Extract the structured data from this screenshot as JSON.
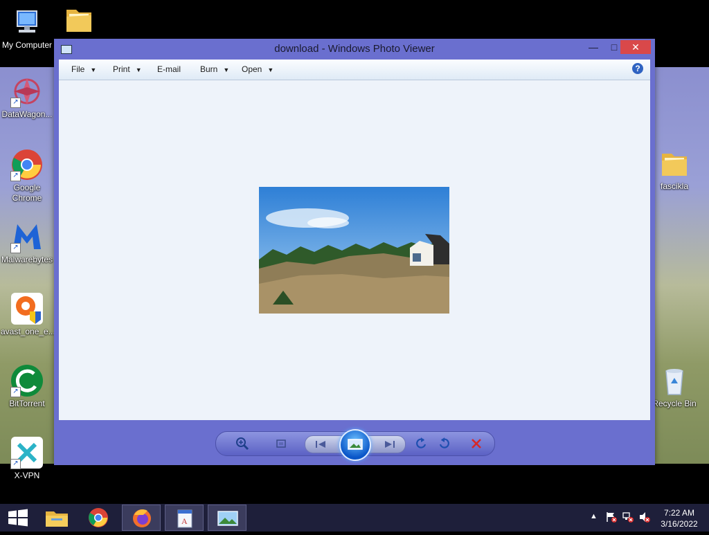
{
  "desktop": {
    "icons_left": [
      {
        "label": "My Computer",
        "icon": "computer-icon"
      },
      {
        "label": "DataWagon...",
        "icon": "datawagon-icon"
      },
      {
        "label": "Google\nChrome",
        "icon": "chrome-icon"
      },
      {
        "label": "Malwarebytes",
        "icon": "malwarebytes-icon"
      },
      {
        "label": "avast_one_e...",
        "icon": "avast-icon"
      },
      {
        "label": "BitTorrent",
        "icon": "bittorrent-icon"
      },
      {
        "label": "X-VPN",
        "icon": "xvpn-icon"
      }
    ],
    "icons_right": [
      {
        "label": "fascikla",
        "icon": "folder-icon"
      },
      {
        "label": "Recycle Bin",
        "icon": "recycle-bin-icon"
      }
    ]
  },
  "window": {
    "title": "download - Windows Photo Viewer",
    "controls": {
      "minimize": "—",
      "maximize": "□",
      "close": "✕"
    },
    "menu": [
      {
        "label": "File",
        "has_arrow": true
      },
      {
        "label": "Print",
        "has_arrow": true
      },
      {
        "label": "E-mail",
        "has_arrow": false
      },
      {
        "label": "Burn",
        "has_arrow": true
      },
      {
        "label": "Open",
        "has_arrow": true
      }
    ],
    "help": "?",
    "toolbar": [
      "zoom-icon",
      "actual-size-icon",
      "previous-icon",
      "slideshow-icon",
      "next-icon",
      "rotate-left-icon",
      "rotate-right-icon",
      "delete-icon"
    ]
  },
  "taskbar": {
    "pinned": [
      "windows-start-icon",
      "file-explorer-icon",
      "chrome-icon",
      "firefox-icon",
      "document-viewer-icon",
      "photo-viewer-icon"
    ],
    "clock": {
      "time": "7:22 AM",
      "date": "3/16/2022"
    },
    "tray": {
      "show_hidden": "▲"
    }
  }
}
